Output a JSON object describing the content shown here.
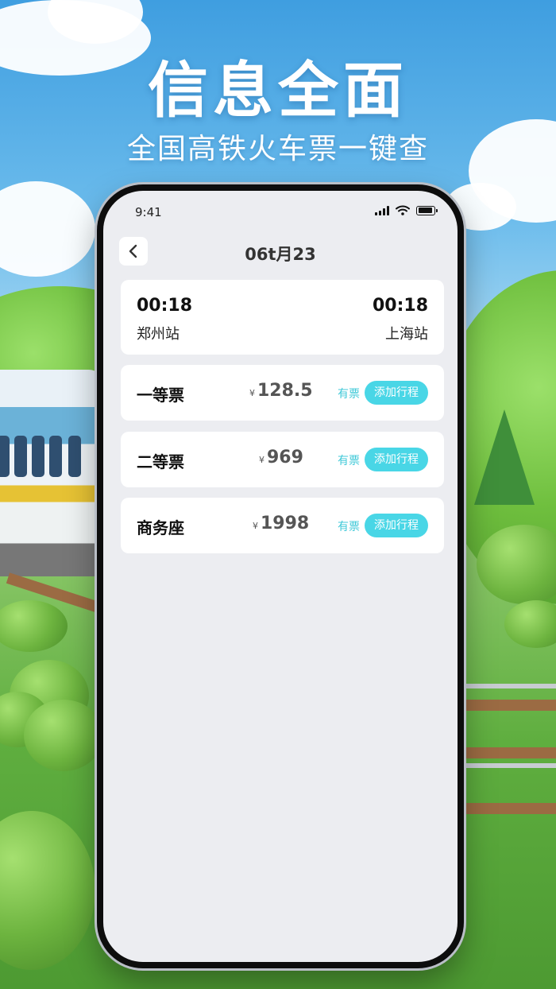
{
  "banner": {
    "headline": "信息全面",
    "subline": "全国高铁火车票一键查"
  },
  "status_bar": {
    "time": "9:41"
  },
  "nav": {
    "title": "06t月23"
  },
  "route": {
    "depart_time": "00:18",
    "depart_station": "郑州站",
    "arrive_time": "00:18",
    "arrive_station": "上海站"
  },
  "tickets": [
    {
      "name": "一等票",
      "currency": "¥",
      "price": "128.5",
      "availability": "有票",
      "action": "添加行程"
    },
    {
      "name": "二等票",
      "currency": "¥",
      "price": "969",
      "availability": "有票",
      "action": "添加行程"
    },
    {
      "name": "商务座",
      "currency": "¥",
      "price": "1998",
      "availability": "有票",
      "action": "添加行程"
    }
  ],
  "colors": {
    "accent": "#49d6e6",
    "availability_text": "#40c9d8",
    "screen_bg": "#ecedf1"
  }
}
